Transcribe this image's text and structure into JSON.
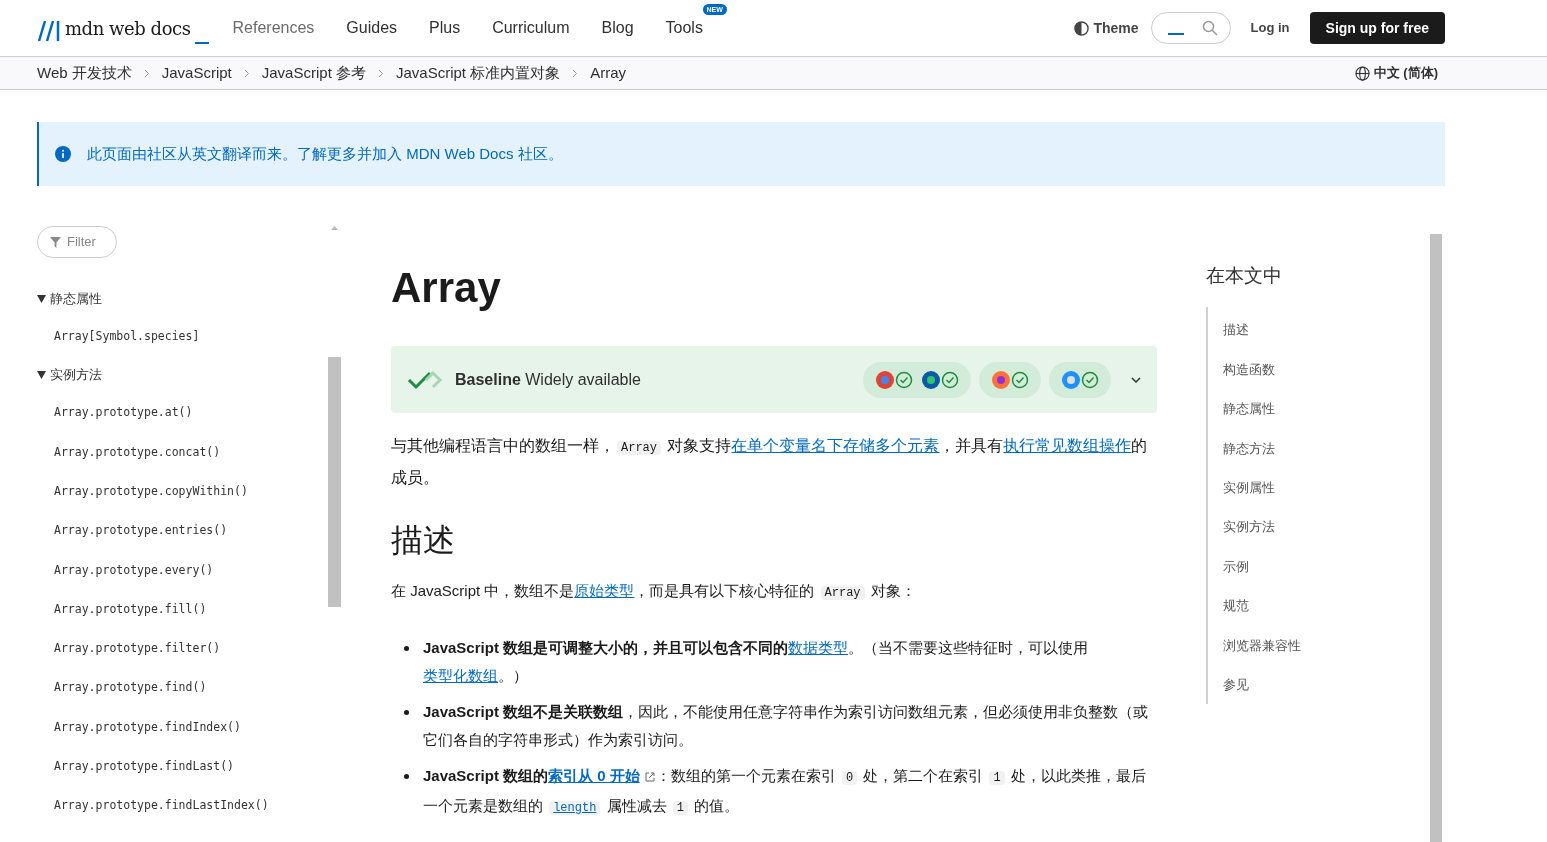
{
  "header": {
    "logo": "mdn web docs",
    "nav": [
      {
        "label": "References",
        "selected": true
      },
      {
        "label": "Guides",
        "selected": false
      },
      {
        "label": "Plus",
        "selected": false
      },
      {
        "label": "Curriculum",
        "selected": false
      },
      {
        "label": "Blog",
        "selected": false
      },
      {
        "label": "Tools",
        "selected": false,
        "badge": "NEW"
      }
    ],
    "theme": "Theme",
    "login": "Log in",
    "signup": "Sign up for free"
  },
  "breadcrumbs": [
    "Web 开发技术",
    "JavaScript",
    "JavaScript 参考",
    "JavaScript 标准内置对象",
    "Array"
  ],
  "language": "中文 (简体)",
  "notice": "此页面由社区从英文翻译而来。了解更多并加入 MDN Web Docs 社区。",
  "sidebar": {
    "filter": {
      "placeholder": "Filter"
    },
    "sections": [
      {
        "title": "静态属性",
        "expanded": true,
        "children": [
          {
            "label": "Array[Symbol.species]"
          }
        ]
      },
      {
        "title": "实例方法",
        "expanded": true,
        "children": [
          {
            "label": "Array.prototype.at()"
          },
          {
            "label": "Array.prototype.concat()"
          },
          {
            "label": "Array.prototype.copyWithin()"
          },
          {
            "label": "Array.prototype.entries()"
          },
          {
            "label": "Array.prototype.every()"
          },
          {
            "label": "Array.prototype.fill()"
          },
          {
            "label": "Array.prototype.filter()"
          },
          {
            "label": "Array.prototype.find()"
          },
          {
            "label": "Array.prototype.findIndex()"
          },
          {
            "label": "Array.prototype.findLast()"
          },
          {
            "label": "Array.prototype.findLastIndex()"
          }
        ]
      }
    ]
  },
  "article": {
    "title": "Array",
    "baseline": {
      "label": "Baseline",
      "status": "Widely available",
      "groups": [
        {
          "browsers": [
            {
              "kind": "chrome"
            },
            {
              "kind": "edge"
            }
          ]
        },
        {
          "browsers": [
            {
              "kind": "firefox"
            }
          ]
        },
        {
          "browsers": [
            {
              "kind": "safari"
            }
          ]
        }
      ]
    },
    "intro": [
      {
        "kind": "text",
        "text": "与其他编程语言中的数组一样，"
      },
      {
        "kind": "code",
        "text": "Array"
      },
      {
        "kind": "text",
        "text": " 对象支持"
      },
      {
        "kind": "link",
        "text": "在单个变量名下存储多个元素"
      },
      {
        "kind": "text",
        "text": "，并具有"
      },
      {
        "kind": "link",
        "text": "执行常见数组操作"
      },
      {
        "kind": "text",
        "text": "的成员。"
      }
    ],
    "heading": "描述",
    "description": [
      {
        "kind": "text",
        "text": "在 JavaScript 中，数组不是"
      },
      {
        "kind": "link",
        "text": "原始类型"
      },
      {
        "kind": "text",
        "text": "，而是具有以下核心特征的 "
      },
      {
        "kind": "code",
        "text": "Array"
      },
      {
        "kind": "text",
        "text": " 对象："
      }
    ],
    "bullets": [
      [
        {
          "kind": "bold",
          "text": "JavaScript 数组是可调整大小的，并且可以包含不同的"
        },
        {
          "kind": "link",
          "text": "数据类型"
        },
        {
          "kind": "text",
          "text": "。（当不需要这些特征时，可以使用"
        },
        {
          "kind": "link",
          "text": "类型化数组"
        },
        {
          "kind": "text",
          "text": "。）"
        }
      ],
      [
        {
          "kind": "bold",
          "text": "JavaScript 数组不是关联数组"
        },
        {
          "kind": "text",
          "text": "，因此，不能使用任意字符串作为索引访问数组元素，但必须使用非负整数（或它们各自的字符串形式）作为索引访问。"
        }
      ],
      [
        {
          "kind": "bold",
          "text": "JavaScript 数组的"
        },
        {
          "kind": "extlink",
          "text": "索引从 0 开始"
        },
        {
          "kind": "text",
          "text": "：数组的第一个元素在索引 "
        },
        {
          "kind": "code",
          "text": "0"
        },
        {
          "kind": "text",
          "text": " 处，第二个在索引 "
        },
        {
          "kind": "code",
          "text": "1"
        },
        {
          "kind": "text",
          "text": " 处，以此类推，最后一个元素是数组的 "
        },
        {
          "kind": "codelink",
          "text": "length"
        },
        {
          "kind": "text",
          "text": " 属性减去 "
        },
        {
          "kind": "code",
          "text": "1"
        },
        {
          "kind": "text",
          "text": " 的值。"
        }
      ]
    ]
  },
  "toc": {
    "title": "在本文中",
    "items": [
      "描述",
      "构造函数",
      "静态属性",
      "静态方法",
      "实例属性",
      "实例方法",
      "示例",
      "规范",
      "浏览器兼容性",
      "参见"
    ]
  }
}
